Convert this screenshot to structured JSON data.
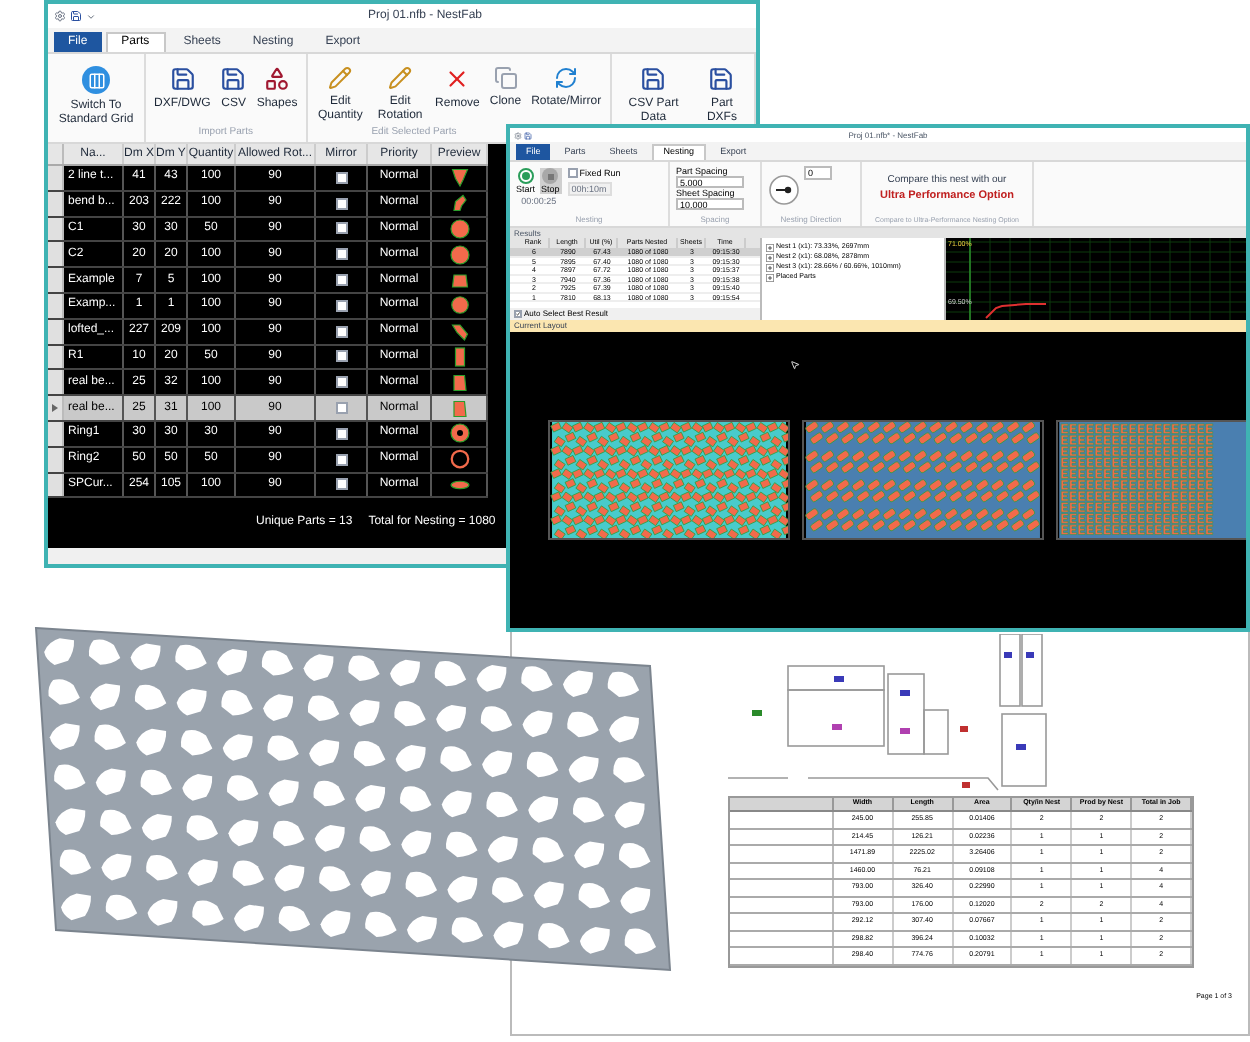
{
  "parts_window": {
    "title": "Proj 01.nfb - NestFab",
    "tabs": [
      {
        "label": "File",
        "kind": "menu",
        "selected": false
      },
      {
        "label": "Parts",
        "kind": "tab",
        "selected": true
      },
      {
        "label": "Sheets",
        "kind": "tab",
        "selected": false
      },
      {
        "label": "Nesting",
        "kind": "tab",
        "selected": false
      },
      {
        "label": "Export",
        "kind": "tab",
        "selected": false
      }
    ],
    "ribbon_groups": [
      {
        "buttons": [
          "Switch To Standard Grid"
        ]
      },
      {
        "label": "Import Parts",
        "buttons": [
          "DXF/DWG",
          "CSV",
          "Shapes"
        ]
      },
      {
        "label": "Edit Selected Parts",
        "buttons": [
          "Edit Quantity",
          "Edit Rotation",
          "Remove",
          "Clone",
          "Rotate/Mirror"
        ]
      },
      {
        "buttons": [
          "CSV Part Data",
          "Part DXFs"
        ]
      }
    ],
    "table": {
      "columns": [
        "Na...",
        "Dm X",
        "Dm Y",
        "Quantity",
        "Allowed Rot...",
        "Mirror",
        "Priority",
        "Preview"
      ],
      "rows": [
        {
          "cells": [
            "2 line t...",
            "41",
            "43",
            "100",
            "90"
          ],
          "mirror": false,
          "priority": "Normal",
          "selected": false
        },
        {
          "cells": [
            "bend b...",
            "203",
            "222",
            "100",
            "90"
          ],
          "mirror": false,
          "priority": "Normal",
          "selected": false
        },
        {
          "cells": [
            "C1",
            "30",
            "30",
            "50",
            "90"
          ],
          "mirror": false,
          "priority": "Normal",
          "selected": false
        },
        {
          "cells": [
            "C2",
            "20",
            "20",
            "100",
            "90"
          ],
          "mirror": false,
          "priority": "Normal",
          "selected": false
        },
        {
          "cells": [
            "Example",
            "7",
            "5",
            "100",
            "90"
          ],
          "mirror": false,
          "priority": "Normal",
          "selected": false
        },
        {
          "cells": [
            "Examp...",
            "1",
            "1",
            "100",
            "90"
          ],
          "mirror": false,
          "priority": "Normal",
          "selected": false
        },
        {
          "cells": [
            "lofted_...",
            "227",
            "209",
            "100",
            "90"
          ],
          "mirror": false,
          "priority": "Normal",
          "selected": false
        },
        {
          "cells": [
            "R1",
            "10",
            "20",
            "50",
            "90"
          ],
          "mirror": false,
          "priority": "Normal",
          "selected": false
        },
        {
          "cells": [
            "real be...",
            "25",
            "32",
            "100",
            "90"
          ],
          "mirror": false,
          "priority": "Normal",
          "selected": false
        },
        {
          "cells": [
            "real be...",
            "25",
            "31",
            "100",
            "90"
          ],
          "mirror": false,
          "priority": "Normal",
          "selected": true
        },
        {
          "cells": [
            "Ring1",
            "30",
            "30",
            "30",
            "90"
          ],
          "mirror": false,
          "priority": "Normal",
          "selected": false
        },
        {
          "cells": [
            "Ring2",
            "50",
            "50",
            "50",
            "90"
          ],
          "mirror": false,
          "priority": "Normal",
          "selected": false
        },
        {
          "cells": [
            "SPCur...",
            "254",
            "105",
            "100",
            "90"
          ],
          "mirror": false,
          "priority": "Normal",
          "selected": false
        }
      ]
    },
    "footer": [
      "Unique Parts = 13",
      "Total for Nesting = 1080"
    ]
  },
  "nesting_window": {
    "title": "Proj 01.nfb* - NestFab",
    "tabs": [
      {
        "label": "File",
        "kind": "menu",
        "selected": false
      },
      {
        "label": "Parts",
        "kind": "tab",
        "selected": false
      },
      {
        "label": "Sheets",
        "kind": "tab",
        "selected": false
      },
      {
        "label": "Nesting",
        "kind": "tab",
        "selected": true
      },
      {
        "label": "Export",
        "kind": "tab",
        "selected": false
      }
    ],
    "ribbon": {
      "start": "Start",
      "stop": "Stop",
      "timer": "00:00:25",
      "fixed_run": {
        "label": "Fixed Run",
        "checked": false
      },
      "duration": {
        "value": "00h:10m",
        "disabled": true
      },
      "group_nesting": "Nesting",
      "part_spacing": {
        "label": "Part Spacing",
        "value": "5.000"
      },
      "sheet_spacing": {
        "label": "Sheet Spacing",
        "value": "10.000"
      },
      "group_spacing": "Spacing",
      "direction": "0",
      "group_direction": "Nesting Direction",
      "promo_line1": "Compare this nest with our",
      "promo_line2": "Ultra Performance Option",
      "group_compare": "Compare to Ultra-Performance Nesting Option"
    },
    "results_label": "Results",
    "results": {
      "columns": [
        "Rank",
        "Length",
        "Util (%)",
        "Parts Nested",
        "Sheets",
        "Time"
      ],
      "rows": [
        {
          "cells": [
            "6",
            "7890",
            "67.43",
            "1080 of 1080",
            "3",
            "09:15:30"
          ],
          "selected": true
        },
        {
          "cells": [
            "5",
            "7895",
            "67.40",
            "1080 of 1080",
            "3",
            "09:15:30"
          ],
          "selected": false
        },
        {
          "cells": [
            "4",
            "7897",
            "67.72",
            "1080 of 1080",
            "3",
            "09:15:37"
          ],
          "selected": false
        },
        {
          "cells": [
            "3",
            "7940",
            "67.36",
            "1080 of 1080",
            "3",
            "09:15:38"
          ],
          "selected": false
        },
        {
          "cells": [
            "2",
            "7925",
            "67.39",
            "1080 of 1080",
            "3",
            "09:15:40"
          ],
          "selected": false
        },
        {
          "cells": [
            "1",
            "7810",
            "68.13",
            "1080 of 1080",
            "3",
            "09:15:54"
          ],
          "selected": false
        }
      ]
    },
    "tree": [
      {
        "label": "Nest 1 (x1): 73.33%, 2697mm",
        "expanded": false
      },
      {
        "label": "Nest 2 (x1): 68.08%, 2878mm",
        "expanded": false
      },
      {
        "label": "Nest 3 (x1): 28.66% / 60.66%, 1010mm)",
        "expanded": false
      },
      {
        "label": "Placed Parts",
        "expanded": false
      }
    ],
    "auto_select": {
      "label": "Auto Select Best Result",
      "checked": true
    },
    "chart_labels": [
      "71.00%",
      "69.50%"
    ],
    "current_layout": "Current Layout"
  },
  "report": {
    "columns": [
      "Width",
      "Length",
      "Area",
      "Qty/in Nest",
      "Prod by Nest",
      "Total in Job"
    ],
    "rows": [
      [
        "245.00",
        "255.85",
        "0.01406",
        "2",
        "2",
        "2"
      ],
      [
        "214.45",
        "126.21",
        "0.02236",
        "1",
        "1",
        "2"
      ],
      [
        "1471.89",
        "2225.02",
        "3.26406",
        "1",
        "1",
        "2"
      ],
      [
        "1460.00",
        "76.21",
        "0.09108",
        "1",
        "1",
        "4"
      ],
      [
        "793.00",
        "326.40",
        "0.22990",
        "1",
        "1",
        "4"
      ],
      [
        "793.00",
        "176.00",
        "0.12020",
        "2",
        "2",
        "4"
      ],
      [
        "292.12",
        "307.40",
        "0.07667",
        "1",
        "1",
        "2"
      ],
      [
        "298.82",
        "396.24",
        "0.10032",
        "1",
        "1",
        "2"
      ],
      [
        "298.40",
        "774.76",
        "0.20791",
        "1",
        "1",
        "2"
      ]
    ],
    "page": "Page 1 of 3"
  }
}
